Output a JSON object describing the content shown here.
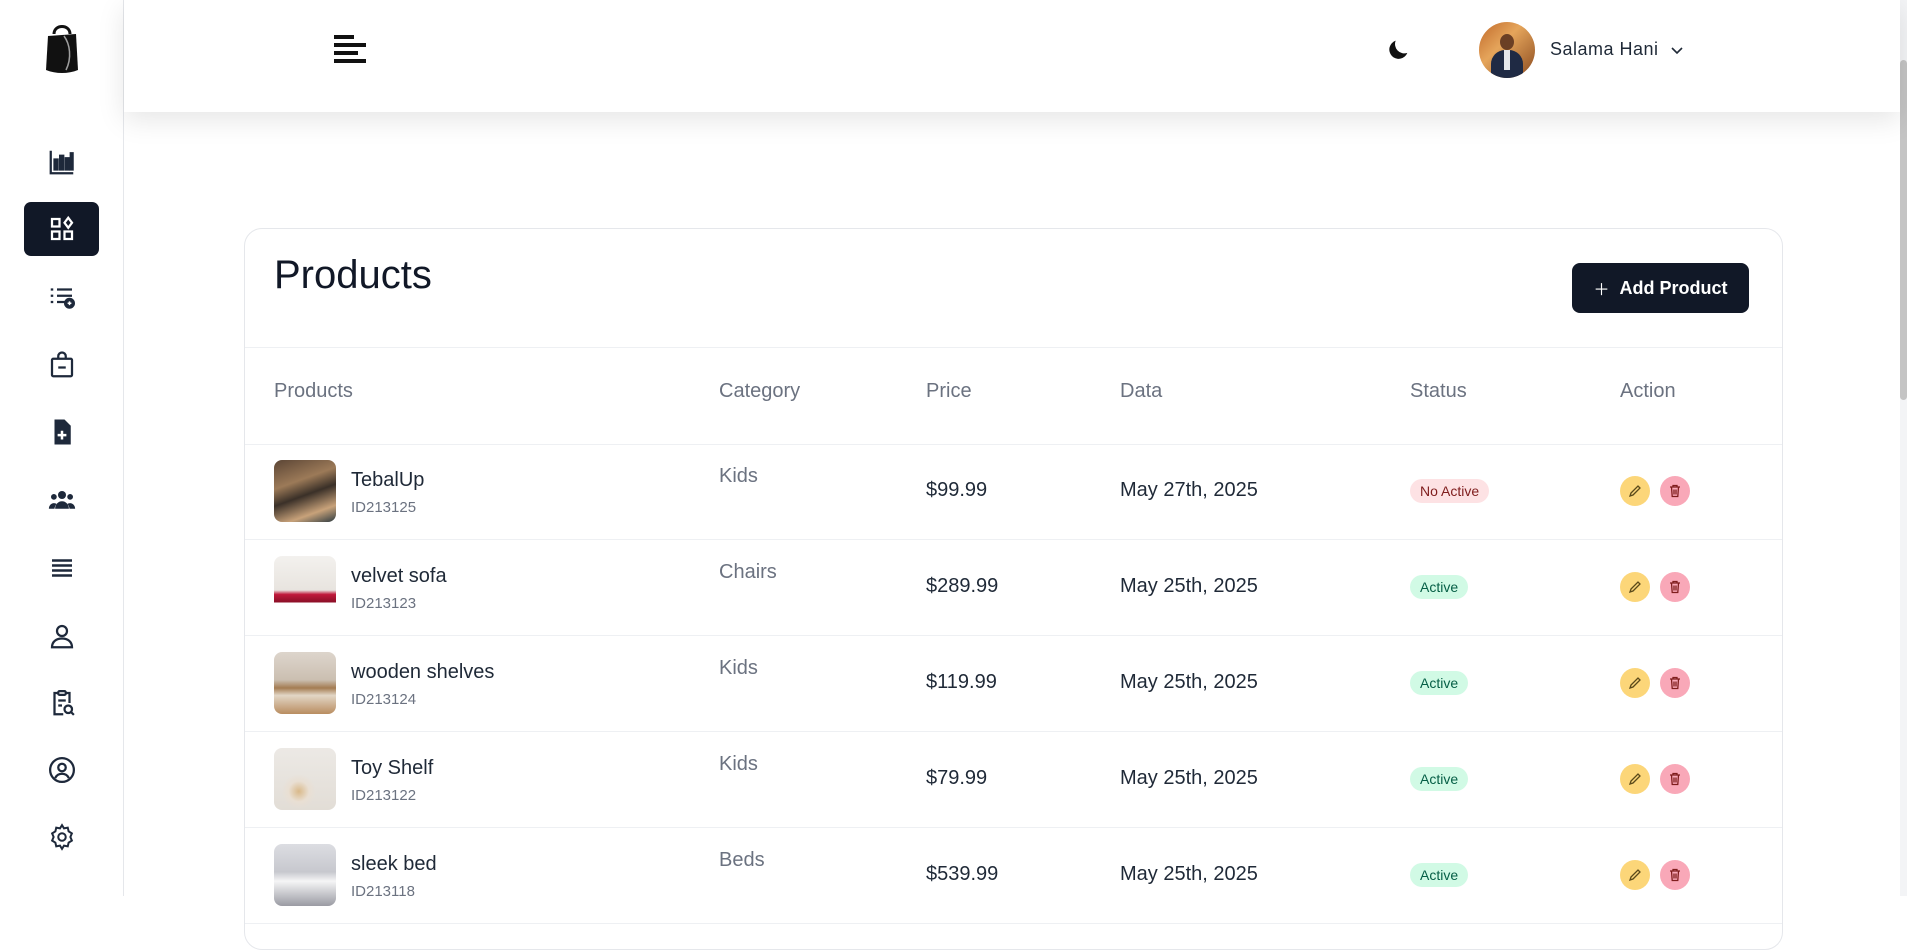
{
  "user": {
    "name": "Salama Hani"
  },
  "page": {
    "title": "Products",
    "add_button": "Add Product"
  },
  "sidebar": {
    "items": [
      {
        "icon": "bar-chart-icon",
        "active": false
      },
      {
        "icon": "dashboard-grid-icon",
        "active": true
      },
      {
        "icon": "list-add-icon",
        "active": false
      },
      {
        "icon": "shopping-bag-minus-icon",
        "active": false
      },
      {
        "icon": "file-add-icon",
        "active": false
      },
      {
        "icon": "users-group-icon",
        "active": false
      },
      {
        "icon": "list-lines-icon",
        "active": false
      },
      {
        "icon": "user-icon",
        "active": false
      },
      {
        "icon": "clipboard-search-icon",
        "active": false
      },
      {
        "icon": "user-circle-icon",
        "active": false
      },
      {
        "icon": "gear-icon",
        "active": false
      }
    ]
  },
  "table": {
    "headers": [
      "Products",
      "Category",
      "Price",
      "Data",
      "Status",
      "Action"
    ],
    "rows": [
      {
        "name": "TebalUp",
        "id": "ID213125",
        "category": "Kids",
        "price": "$99.99",
        "date": "May 27th, 2025",
        "status": "No Active"
      },
      {
        "name": "velvet sofa",
        "id": "ID213123",
        "category": "Chairs",
        "price": "$289.99",
        "date": "May 25th, 2025",
        "status": "Active"
      },
      {
        "name": "wooden shelves",
        "id": "ID213124",
        "category": "Kids",
        "price": "$119.99",
        "date": "May 25th, 2025",
        "status": "Active"
      },
      {
        "name": "Toy Shelf",
        "id": "ID213122",
        "category": "Kids",
        "price": "$79.99",
        "date": "May 25th, 2025",
        "status": "Active"
      },
      {
        "name": "sleek bed",
        "id": "ID213118",
        "category": "Beds",
        "price": "$539.99",
        "date": "May 25th, 2025",
        "status": "Active"
      }
    ]
  },
  "colors": {
    "primary": "#111827",
    "active_badge_bg": "#d1fae5",
    "inactive_badge_bg": "#fde2e4",
    "edit_button": "#fcd679",
    "delete_button": "#f9a8b8"
  }
}
